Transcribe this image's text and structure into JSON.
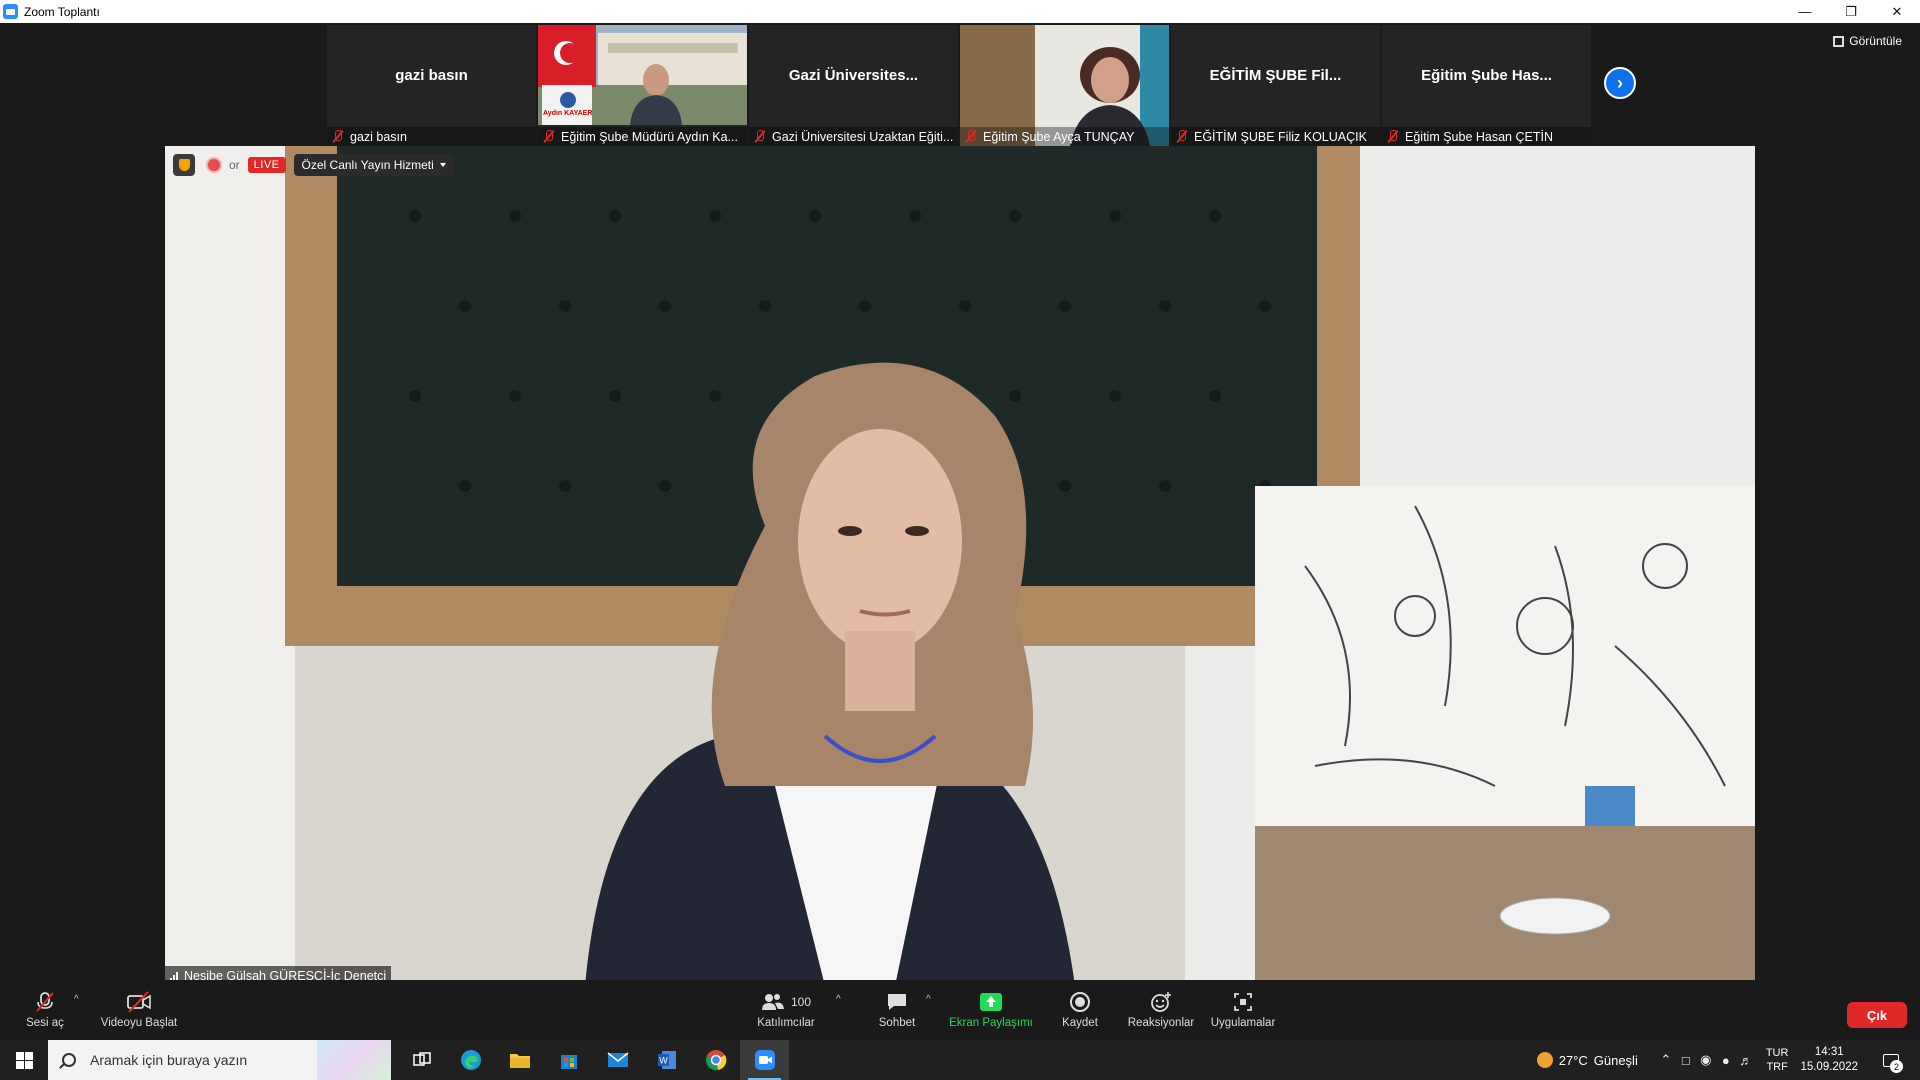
{
  "window": {
    "title": "Zoom Toplantı"
  },
  "view_button": {
    "label": "Görüntüle"
  },
  "participants_strip": [
    {
      "display": "gazi basın",
      "name": "gazi basın",
      "video": false
    },
    {
      "display": "",
      "name": "Eğitim Şube Müdürü Aydın Ka...",
      "video": true,
      "caption": "Aydın KAYAER"
    },
    {
      "display": "Gazi Üniversites...",
      "name": "Gazi Üniversitesi Uzaktan Eğiti...",
      "video": false
    },
    {
      "display": "",
      "name": "Eğitim Şube Ayça TUNÇAY",
      "video": true
    },
    {
      "display": "EĞİTİM ŞUBE Fil...",
      "name": "EĞİTİM ŞUBE Filiz KOLUAÇIK",
      "video": false
    },
    {
      "display": "Eğitim Şube Has...",
      "name": "Eğitim Şube Hasan ÇETİN",
      "video": false
    }
  ],
  "main_video": {
    "recording_text": "or",
    "live_badge": "LIVE",
    "live_service": "Özel Canlı Yayın Hizmeti",
    "speaker_name": "Nesibe Gülşah GÜREŞCİ-İç Denetçi"
  },
  "toolbar": {
    "unmute": "Sesi aç",
    "start_video": "Videoyu Başlat",
    "participants": "Katılımcılar",
    "participant_count": "100",
    "chat": "Sohbet",
    "share": "Ekran Paylaşımı",
    "record": "Kaydet",
    "reactions": "Reaksiyonlar",
    "apps": "Uygulamalar",
    "leave": "Çık"
  },
  "colors": {
    "share_green": "#23d959",
    "leave_red": "#e02828",
    "accent_blue": "#0e72ed"
  },
  "taskbar": {
    "search_placeholder": "Aramak için buraya yazın",
    "weather_temp": "27°C",
    "weather_text": "Güneşli",
    "lang_top": "TUR",
    "lang_bottom": "TRF",
    "time": "14:31",
    "date": "15.09.2022",
    "notifications": "2"
  }
}
